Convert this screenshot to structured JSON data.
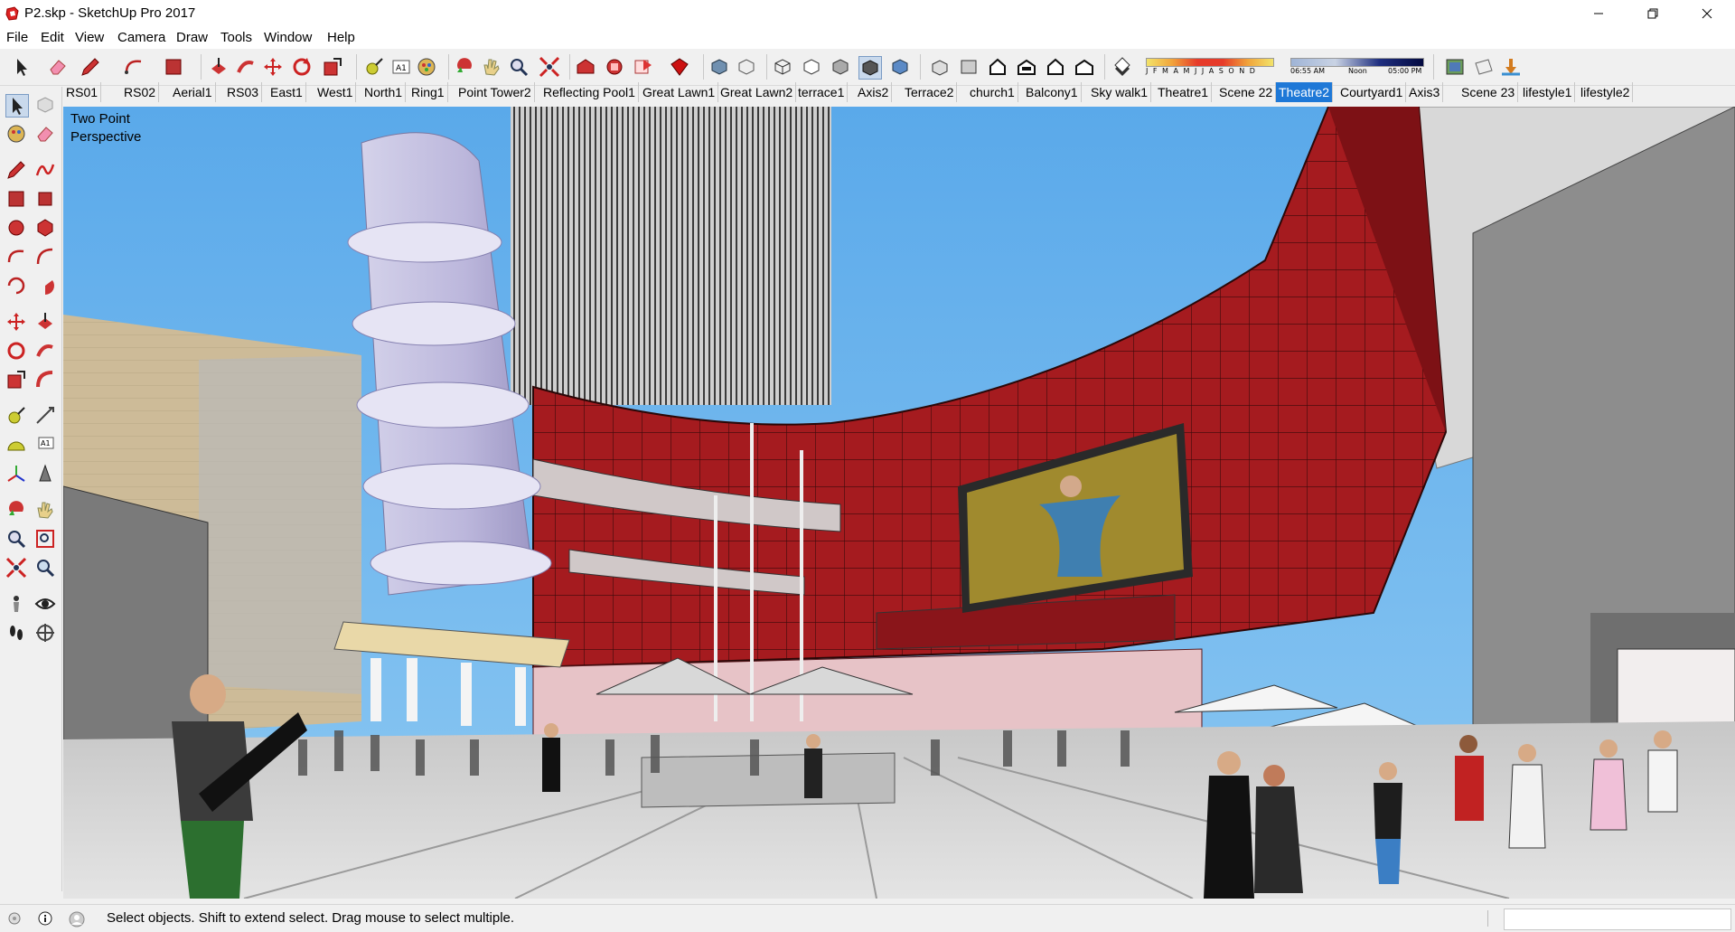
{
  "window": {
    "title": "P2.skp - SketchUp Pro 2017",
    "controls": [
      "minimize",
      "restore",
      "close"
    ]
  },
  "menu": {
    "items": [
      "File",
      "Edit",
      "View",
      "Camera",
      "Draw",
      "Tools",
      "Window",
      "Help"
    ]
  },
  "toolbar": {
    "shadow_months": "J F M A M J J A S O N D",
    "time_start": "06:55 AM",
    "time_noon": "Noon",
    "time_end": "05:00 PM"
  },
  "scenes": {
    "tabs": [
      "RS01",
      "RS02",
      "Aerial1",
      "RS03",
      "East1",
      "West1",
      "North1",
      "Ring1",
      "Point Tower2",
      "Reflecting Pool1",
      "Great Lawn1",
      "Great Lawn2",
      "terrace1",
      "Axis2",
      "Terrace2",
      "church1",
      "Balcony1",
      "Sky walk1",
      "Theatre1",
      "Scene 22",
      "Theatre2",
      "Courtyard1",
      "Axis3",
      "Scene 23",
      "lifestyle1",
      "lifestyle2"
    ],
    "active": "Theatre2"
  },
  "viewport": {
    "camera_label_line1": "Two Point",
    "camera_label_line2": "Perspective"
  },
  "status": {
    "hint": "Select objects. Shift to extend select. Drag mouse to select multiple."
  },
  "colors": {
    "selected_tab": "#1e78d7",
    "facade_red": "#a51b1f",
    "sky": "#6ab4ea"
  }
}
